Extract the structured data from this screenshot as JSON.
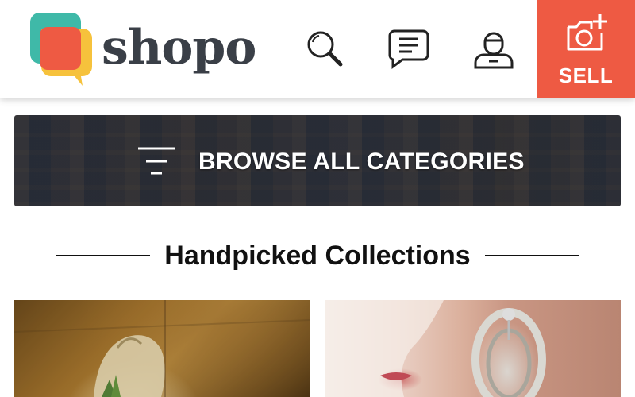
{
  "header": {
    "brand": "shopo",
    "icons": [
      "search-icon",
      "chat-icon",
      "profile-icon"
    ],
    "sell_label": "SELL"
  },
  "browse": {
    "label": "BROWSE ALL CATEGORIES"
  },
  "collections": {
    "title": "Handpicked Collections"
  },
  "colors": {
    "accent": "#ee5a43",
    "logo_teal": "#3fb9a8",
    "logo_yellow": "#f6c23c",
    "logo_red": "#ee5a43",
    "text_dark": "#3a3f47"
  }
}
